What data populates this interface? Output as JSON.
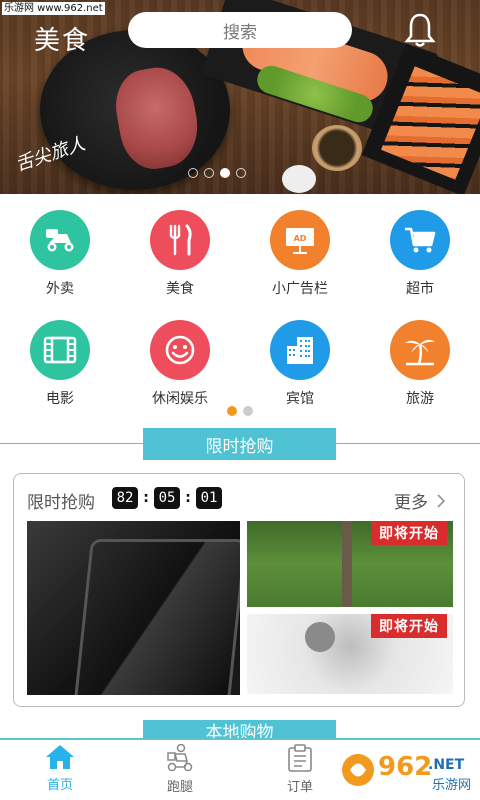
{
  "watermark": {
    "text": "乐游网 www.962.net"
  },
  "banner": {
    "search_label": "搜索",
    "logo_text": "美食",
    "script_text": "舌尖旅人",
    "dots": [
      false,
      false,
      true,
      false
    ]
  },
  "categories": [
    {
      "label": "外卖",
      "icon": "scooter-icon",
      "color": "#2ec4a0"
    },
    {
      "label": "美食",
      "icon": "fork-knife-icon",
      "color": "#ee4e5c"
    },
    {
      "label": "小广告栏",
      "icon": "ad-board-icon",
      "color": "#f2812e"
    },
    {
      "label": "超市",
      "icon": "shopping-cart-icon",
      "color": "#1f9be8"
    },
    {
      "label": "电影",
      "icon": "film-icon",
      "color": "#2ec4a0"
    },
    {
      "label": "休闲娱乐",
      "icon": "smiley-icon",
      "color": "#ee4e5c"
    },
    {
      "label": "宾馆",
      "icon": "hotel-building-icon",
      "color": "#1f9be8"
    },
    {
      "label": "旅游",
      "icon": "palm-tree-icon",
      "color": "#f2812e"
    }
  ],
  "category_pager": {
    "active_page": 1,
    "pages": 2
  },
  "flash_section": {
    "tag": "限时抢购"
  },
  "flash_card": {
    "title": "限时抢购",
    "timer": [
      "82",
      "05",
      "01"
    ],
    "more_label": "更多",
    "badge_text": "即将开始"
  },
  "local_section": {
    "tag": "本地购物"
  },
  "tabbar": {
    "tabs": [
      {
        "label": "首页",
        "icon": "home-icon",
        "active": true
      },
      {
        "label": "跑腿",
        "icon": "delivery-person-icon",
        "active": false
      },
      {
        "label": "订单",
        "icon": "clipboard-icon",
        "active": false
      }
    ]
  },
  "footer_watermark": {
    "big": "962",
    "suffix": ".NET",
    "sub": "乐游网"
  },
  "colors": {
    "accent": "#4fc3d4",
    "tab_active": "#29b2e8",
    "pager_active": "#f29a1e",
    "badge": "#d92d2d"
  }
}
